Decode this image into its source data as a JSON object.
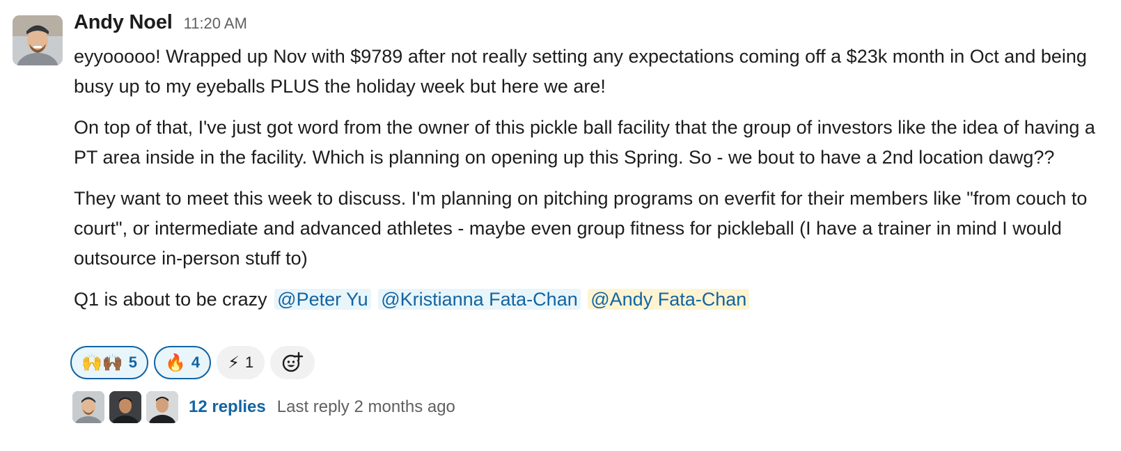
{
  "message": {
    "author": "Andy Noel",
    "timestamp": "11:20 AM",
    "paragraphs": [
      "eyyooooo! Wrapped up Nov with $9789 after not really setting any expectations coming off a $23k month in Oct and being busy up to my eyeballs PLUS the holiday week but here we are!",
      "On top of that, I've just got word from the owner of this pickle ball facility that the group of investors like the idea of having a PT area inside in the facility. Which is planning on opening up this Spring. So - we bout to have a 2nd location dawg??",
      "They want to meet this week to discuss. I'm planning on pitching programs on everfit for their members like \"from couch to court\", or intermediate and advanced athletes - maybe even group fitness for pickleball (I have a trainer in mind I would outsource in-person stuff to)"
    ],
    "last_line_text": "Q1 is about to be crazy",
    "mentions": [
      "@Peter Yu",
      "@Kristianna Fata-Chan",
      "@Andy Fata-Chan"
    ]
  },
  "reactions": [
    {
      "emoji": "🙌🙌🏾",
      "count": "5",
      "active": true
    },
    {
      "emoji": "🔥",
      "count": "4",
      "active": true
    },
    {
      "emoji": "⚡",
      "count": "1",
      "active": false
    }
  ],
  "thread": {
    "replies_label": "12 replies",
    "last_reply": "Last reply 2 months ago"
  },
  "colors": {
    "link": "#1264a3",
    "mention_bg": "#e8f5fa",
    "self_mention_bg": "#fef4d1",
    "muted_text": "#616061"
  }
}
